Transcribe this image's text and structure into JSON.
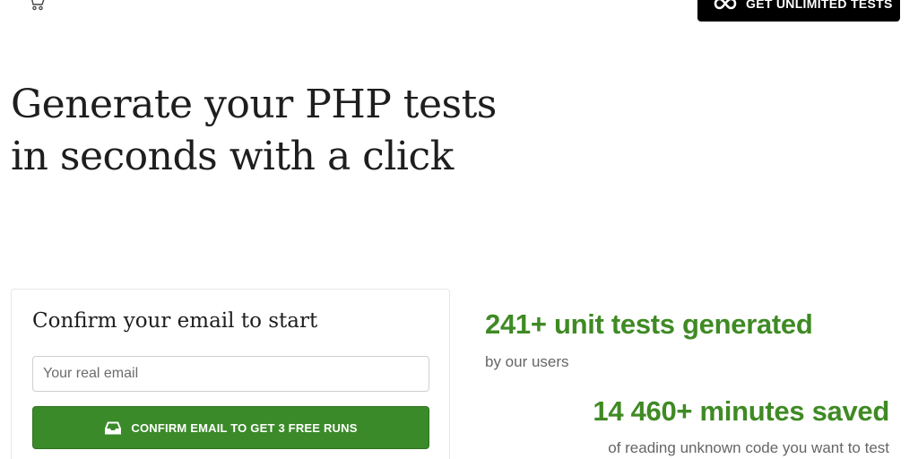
{
  "header": {
    "cart_icon": "cart-icon",
    "cta": {
      "icon": "infinity-icon",
      "label": "GET UNLIMITED TESTS"
    }
  },
  "hero": {
    "title_line1": "Generate your PHP tests",
    "title_line2": "in seconds with a click"
  },
  "email_form": {
    "heading": "Confirm your email to start",
    "email_placeholder": "Your real email",
    "email_value": "",
    "submit_icon": "inbox-icon",
    "submit_label": "CONFIRM EMAIL TO GET 3 FREE RUNS"
  },
  "stats": [
    {
      "value": "241+ unit tests generated",
      "caption": "by our users"
    },
    {
      "value": "14 460+ minutes saved",
      "caption": "of reading unknown code you want to test"
    }
  ],
  "colors": {
    "accent_green": "#3f8a24",
    "button_green": "#3b8a2a",
    "cta_black": "#000000"
  }
}
